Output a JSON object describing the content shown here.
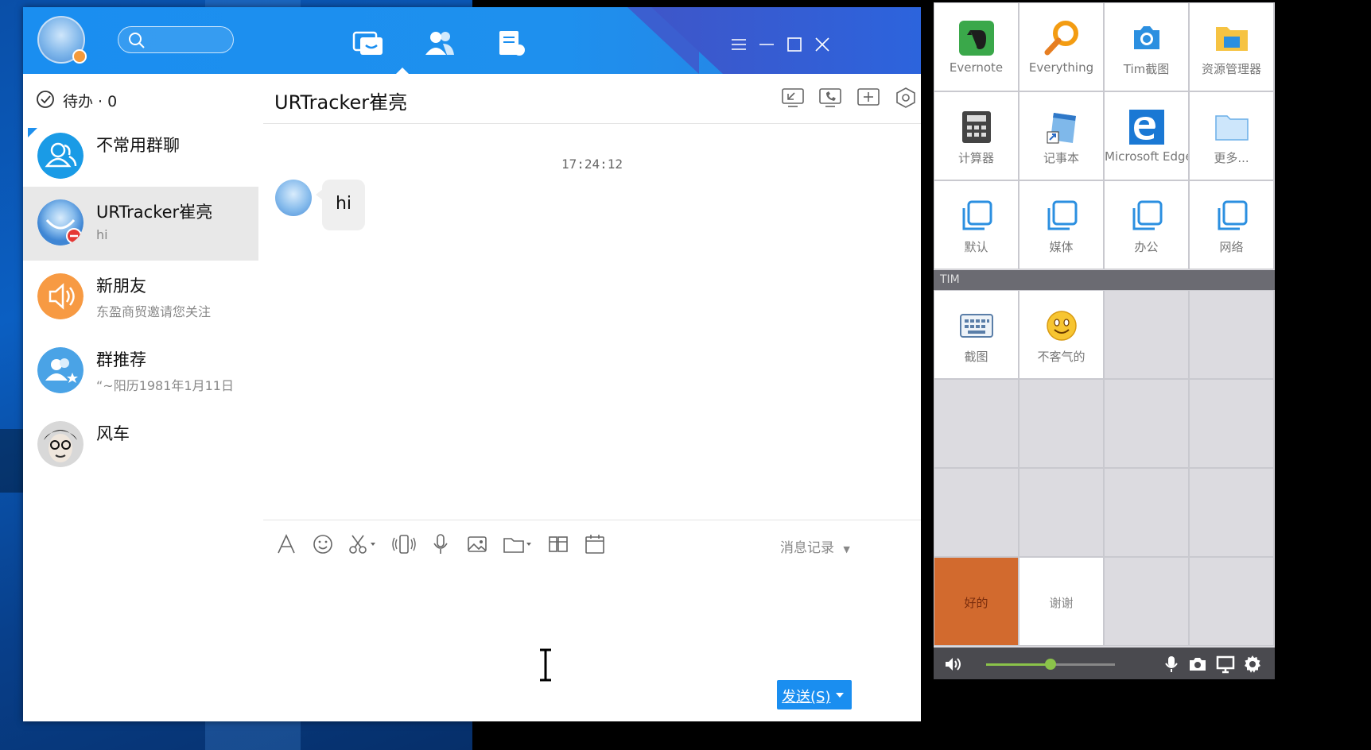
{
  "tim": {
    "search": {
      "placeholder": ""
    },
    "todo": {
      "label": "待办 · 0"
    },
    "contacts": [
      {
        "name": "不常用群聊",
        "sub": ""
      },
      {
        "name": "URTracker崔亮",
        "sub": "hi"
      },
      {
        "name": "新朋友",
        "sub": "东盈商贸邀请您关注"
      },
      {
        "name": "群推荐",
        "sub": "“~阳历1981年1月11日"
      },
      {
        "name": "风车",
        "sub": ""
      }
    ],
    "chat": {
      "title": "URTracker崔亮",
      "timestamp": "17:24:12",
      "message": "hi",
      "history_label": "消息记录",
      "send_label": "发送(S)"
    },
    "colors": {
      "accent": "#1a8ef0",
      "selected": "#e8e8e8"
    }
  },
  "launcher": {
    "apps": [
      {
        "label": "Evernote",
        "icon": "evernote-icon"
      },
      {
        "label": "Everything",
        "icon": "magnifier-icon"
      },
      {
        "label": "Tim截图",
        "icon": "camera-icon"
      },
      {
        "label": "资源管理器",
        "icon": "folder-icon"
      },
      {
        "label": "计算器",
        "icon": "calculator-icon"
      },
      {
        "label": "记事本",
        "icon": "notepad-icon"
      },
      {
        "label": "Microsoft Edge",
        "icon": "edge-icon"
      },
      {
        "label": "更多...",
        "icon": "folder-outline-icon"
      },
      {
        "label": "默认",
        "icon": "copy-icon"
      },
      {
        "label": "媒体",
        "icon": "copy-icon"
      },
      {
        "label": "办公",
        "icon": "copy-icon"
      },
      {
        "label": "网络",
        "icon": "copy-icon"
      }
    ],
    "group_name": "TIM",
    "tim_items": [
      {
        "label": "截图",
        "icon": "keyboard-icon"
      },
      {
        "label": "不客气的",
        "icon": "smiley-icon"
      }
    ],
    "phrases": [
      {
        "label": "好的"
      },
      {
        "label": "谢谢"
      }
    ],
    "volume_level": 0.5,
    "colors": {
      "phrase_active": "#d26a2e",
      "slider": "#8bc34a"
    }
  }
}
